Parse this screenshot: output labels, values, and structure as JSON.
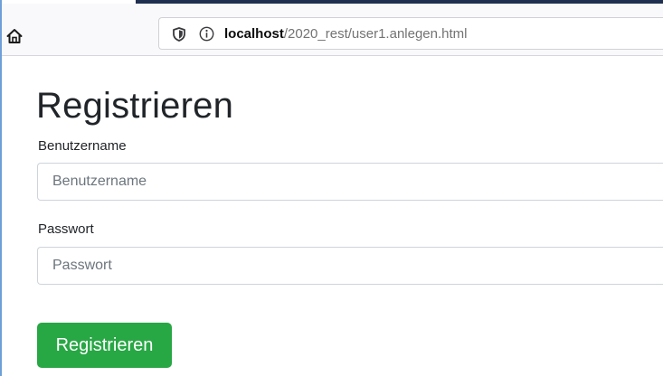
{
  "browser": {
    "url_host": "localhost",
    "url_path": "/2020_rest/user1.anlegen.html",
    "icons": {
      "home": "home-icon",
      "tracking_protection": "shield-icon",
      "site_info": "info-icon"
    }
  },
  "form": {
    "title": "Registrieren",
    "username_label": "Benutzername",
    "username_placeholder": "Benutzername",
    "username_value": "",
    "password_label": "Passwort",
    "password_placeholder": "Passwort",
    "password_value": "",
    "submit_label": "Registrieren"
  },
  "colors": {
    "submit_button": "#28a745",
    "input_border": "#ced4da",
    "text": "#212529",
    "toolbar_background": "#f9f9fb"
  }
}
